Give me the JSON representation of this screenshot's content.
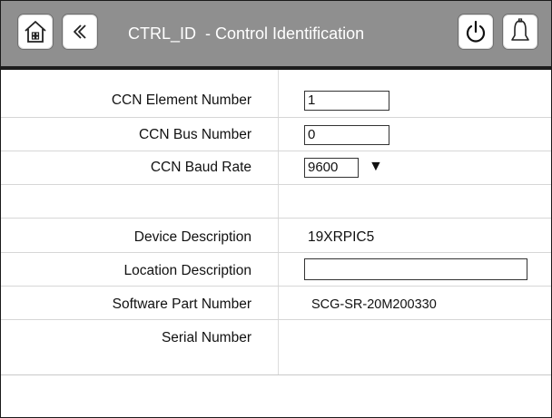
{
  "header": {
    "title": "CTRL_ID  - Control Identification",
    "icons": {
      "home": "home-icon",
      "back": "chevron-left-icon",
      "power": "power-icon",
      "alarm": "bell-icon"
    },
    "colors": {
      "header_bg": "#8f8f8f",
      "button_bg": "#ffffff",
      "title_text": "#ffffff"
    }
  },
  "fields": {
    "ccn_element_number": {
      "label": "CCN Element Number",
      "value": "1"
    },
    "ccn_bus_number": {
      "label": "CCN Bus Number",
      "value": "0"
    },
    "ccn_baud_rate": {
      "label": "CCN Baud Rate",
      "value": "9600",
      "arrow": "▼"
    },
    "device_description": {
      "label": "Device Description",
      "value": "19XRPIC5"
    },
    "location_description": {
      "label": "Location Description",
      "value": ""
    },
    "software_part_number": {
      "label": "Software Part Number",
      "value": "SCG-SR-20M200330"
    },
    "serial_number": {
      "label": "Serial Number",
      "value": ""
    }
  }
}
